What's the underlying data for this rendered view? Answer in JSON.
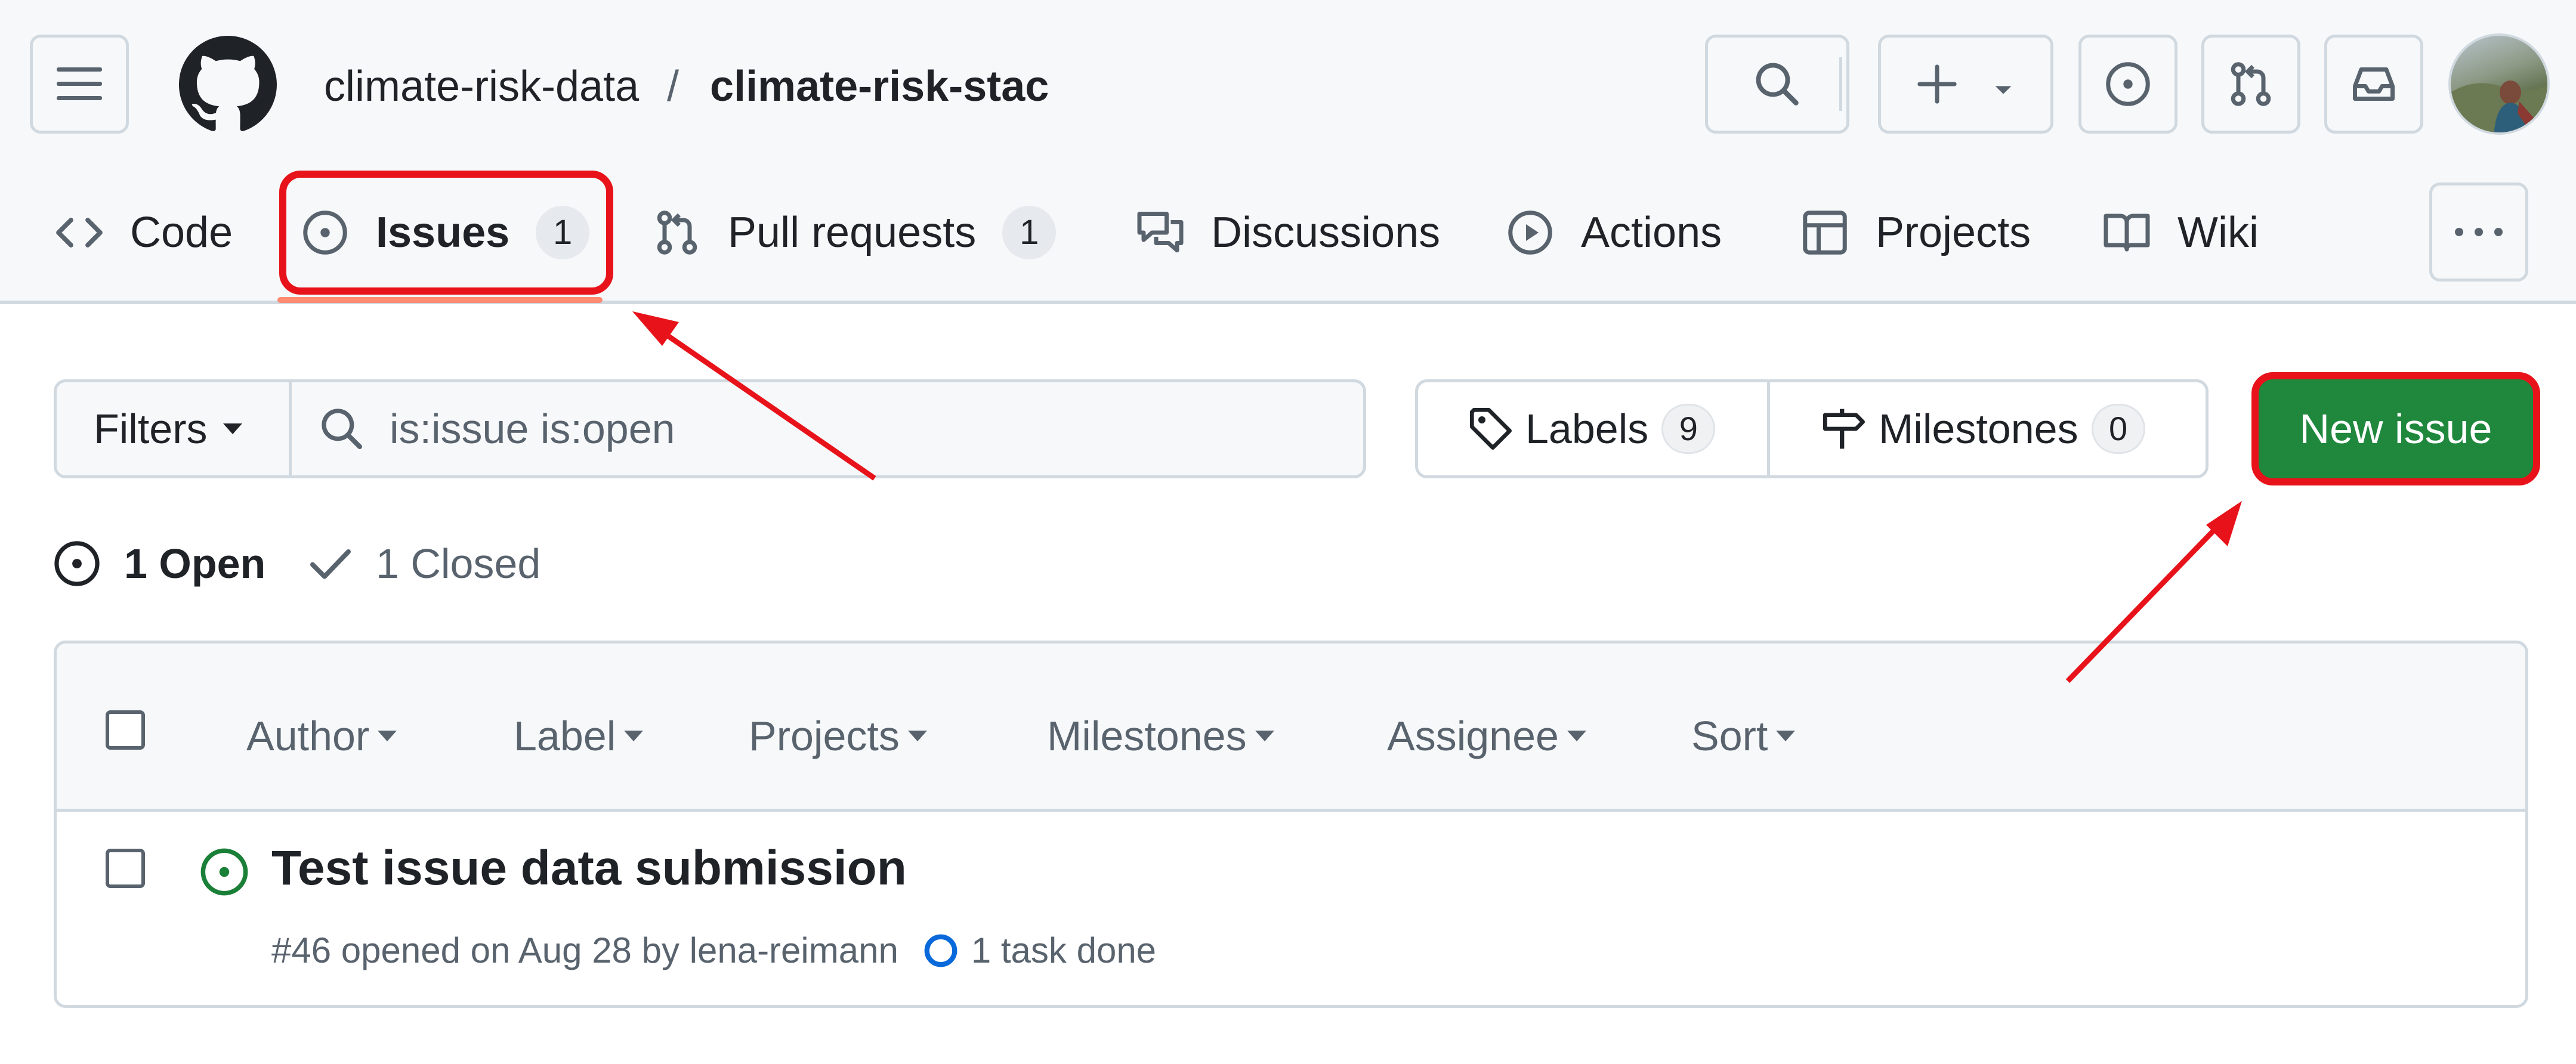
{
  "header": {
    "org": "climate-risk-data",
    "separator": "/",
    "repo": "climate-risk-stac",
    "icons": {
      "menu": "hamburger-icon",
      "logo": "github-mark-icon",
      "search": "search-icon",
      "create": "plus-icon",
      "issues": "issue-opened-icon",
      "pulls": "git-pull-request-icon",
      "inbox": "inbox-icon",
      "avatar": "user-avatar"
    }
  },
  "nav": {
    "tabs": [
      {
        "label": "Code",
        "icon": "code-icon"
      },
      {
        "label": "Issues",
        "count": "1",
        "icon": "issue-opened-icon",
        "selected": true
      },
      {
        "label": "Pull requests",
        "count": "1",
        "icon": "git-pull-request-icon"
      },
      {
        "label": "Discussions",
        "icon": "comment-discussion-icon"
      },
      {
        "label": "Actions",
        "icon": "play-icon"
      },
      {
        "label": "Projects",
        "icon": "table-icon"
      },
      {
        "label": "Wiki",
        "icon": "book-icon"
      }
    ],
    "more_icon": "kebab-horizontal-icon"
  },
  "toolbar": {
    "filters_label": "Filters",
    "search_value": "is:issue is:open",
    "labels_label": "Labels",
    "labels_count": "9",
    "milestones_label": "Milestones",
    "milestones_count": "0",
    "new_issue_label": "New issue"
  },
  "states": {
    "open_label": "1 Open",
    "closed_label": "1 Closed"
  },
  "list": {
    "filters": [
      "Author",
      "Label",
      "Projects",
      "Milestones",
      "Assignee",
      "Sort"
    ],
    "issues": [
      {
        "title": "Test issue data submission",
        "meta": "#46 opened on Aug 28 by lena-reimann",
        "tasks": "1 task done"
      }
    ]
  },
  "colors": {
    "accent_green": "#1f883d",
    "annotation_red": "#e8131a",
    "tab_underline": "#fd8c73"
  }
}
